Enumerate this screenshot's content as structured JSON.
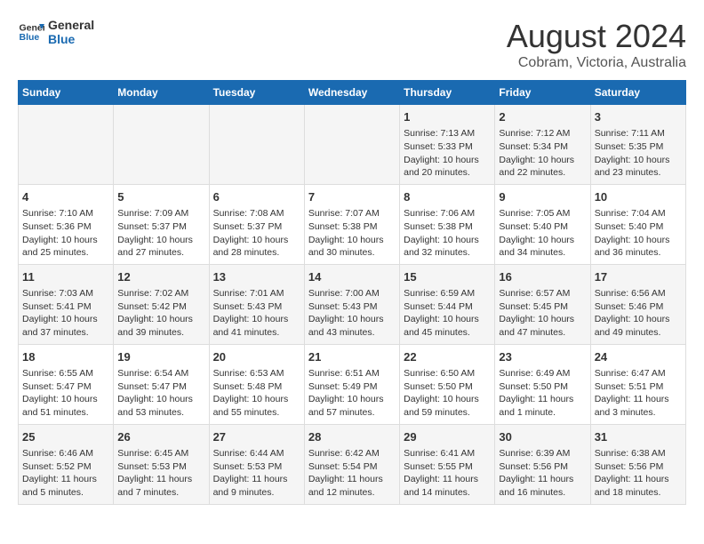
{
  "logo": {
    "line1": "General",
    "line2": "Blue"
  },
  "title": "August 2024",
  "subtitle": "Cobram, Victoria, Australia",
  "days_of_week": [
    "Sunday",
    "Monday",
    "Tuesday",
    "Wednesday",
    "Thursday",
    "Friday",
    "Saturday"
  ],
  "weeks": [
    [
      {
        "day": "",
        "text": ""
      },
      {
        "day": "",
        "text": ""
      },
      {
        "day": "",
        "text": ""
      },
      {
        "day": "",
        "text": ""
      },
      {
        "day": "1",
        "text": "Sunrise: 7:13 AM\nSunset: 5:33 PM\nDaylight: 10 hours\nand 20 minutes."
      },
      {
        "day": "2",
        "text": "Sunrise: 7:12 AM\nSunset: 5:34 PM\nDaylight: 10 hours\nand 22 minutes."
      },
      {
        "day": "3",
        "text": "Sunrise: 7:11 AM\nSunset: 5:35 PM\nDaylight: 10 hours\nand 23 minutes."
      }
    ],
    [
      {
        "day": "4",
        "text": "Sunrise: 7:10 AM\nSunset: 5:36 PM\nDaylight: 10 hours\nand 25 minutes."
      },
      {
        "day": "5",
        "text": "Sunrise: 7:09 AM\nSunset: 5:37 PM\nDaylight: 10 hours\nand 27 minutes."
      },
      {
        "day": "6",
        "text": "Sunrise: 7:08 AM\nSunset: 5:37 PM\nDaylight: 10 hours\nand 28 minutes."
      },
      {
        "day": "7",
        "text": "Sunrise: 7:07 AM\nSunset: 5:38 PM\nDaylight: 10 hours\nand 30 minutes."
      },
      {
        "day": "8",
        "text": "Sunrise: 7:06 AM\nSunset: 5:38 PM\nDaylight: 10 hours\nand 32 minutes."
      },
      {
        "day": "9",
        "text": "Sunrise: 7:05 AM\nSunset: 5:40 PM\nDaylight: 10 hours\nand 34 minutes."
      },
      {
        "day": "10",
        "text": "Sunrise: 7:04 AM\nSunset: 5:40 PM\nDaylight: 10 hours\nand 36 minutes."
      }
    ],
    [
      {
        "day": "11",
        "text": "Sunrise: 7:03 AM\nSunset: 5:41 PM\nDaylight: 10 hours\nand 37 minutes."
      },
      {
        "day": "12",
        "text": "Sunrise: 7:02 AM\nSunset: 5:42 PM\nDaylight: 10 hours\nand 39 minutes."
      },
      {
        "day": "13",
        "text": "Sunrise: 7:01 AM\nSunset: 5:43 PM\nDaylight: 10 hours\nand 41 minutes."
      },
      {
        "day": "14",
        "text": "Sunrise: 7:00 AM\nSunset: 5:43 PM\nDaylight: 10 hours\nand 43 minutes."
      },
      {
        "day": "15",
        "text": "Sunrise: 6:59 AM\nSunset: 5:44 PM\nDaylight: 10 hours\nand 45 minutes."
      },
      {
        "day": "16",
        "text": "Sunrise: 6:57 AM\nSunset: 5:45 PM\nDaylight: 10 hours\nand 47 minutes."
      },
      {
        "day": "17",
        "text": "Sunrise: 6:56 AM\nSunset: 5:46 PM\nDaylight: 10 hours\nand 49 minutes."
      }
    ],
    [
      {
        "day": "18",
        "text": "Sunrise: 6:55 AM\nSunset: 5:47 PM\nDaylight: 10 hours\nand 51 minutes."
      },
      {
        "day": "19",
        "text": "Sunrise: 6:54 AM\nSunset: 5:47 PM\nDaylight: 10 hours\nand 53 minutes."
      },
      {
        "day": "20",
        "text": "Sunrise: 6:53 AM\nSunset: 5:48 PM\nDaylight: 10 hours\nand 55 minutes."
      },
      {
        "day": "21",
        "text": "Sunrise: 6:51 AM\nSunset: 5:49 PM\nDaylight: 10 hours\nand 57 minutes."
      },
      {
        "day": "22",
        "text": "Sunrise: 6:50 AM\nSunset: 5:50 PM\nDaylight: 10 hours\nand 59 minutes."
      },
      {
        "day": "23",
        "text": "Sunrise: 6:49 AM\nSunset: 5:50 PM\nDaylight: 11 hours\nand 1 minute."
      },
      {
        "day": "24",
        "text": "Sunrise: 6:47 AM\nSunset: 5:51 PM\nDaylight: 11 hours\nand 3 minutes."
      }
    ],
    [
      {
        "day": "25",
        "text": "Sunrise: 6:46 AM\nSunset: 5:52 PM\nDaylight: 11 hours\nand 5 minutes."
      },
      {
        "day": "26",
        "text": "Sunrise: 6:45 AM\nSunset: 5:53 PM\nDaylight: 11 hours\nand 7 minutes."
      },
      {
        "day": "27",
        "text": "Sunrise: 6:44 AM\nSunset: 5:53 PM\nDaylight: 11 hours\nand 9 minutes."
      },
      {
        "day": "28",
        "text": "Sunrise: 6:42 AM\nSunset: 5:54 PM\nDaylight: 11 hours\nand 12 minutes."
      },
      {
        "day": "29",
        "text": "Sunrise: 6:41 AM\nSunset: 5:55 PM\nDaylight: 11 hours\nand 14 minutes."
      },
      {
        "day": "30",
        "text": "Sunrise: 6:39 AM\nSunset: 5:56 PM\nDaylight: 11 hours\nand 16 minutes."
      },
      {
        "day": "31",
        "text": "Sunrise: 6:38 AM\nSunset: 5:56 PM\nDaylight: 11 hours\nand 18 minutes."
      }
    ]
  ]
}
